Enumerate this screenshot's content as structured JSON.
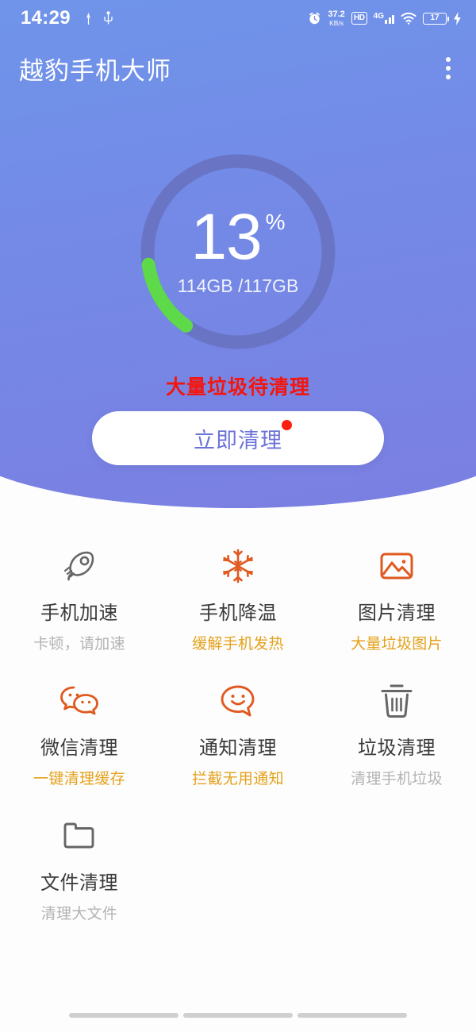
{
  "status_bar": {
    "time": "14:29",
    "net_speed_value": "37.2",
    "net_speed_unit": "KB/s",
    "hd_label": "HD",
    "network_type": "4G",
    "battery_level": "17",
    "icons": [
      "alarm-icon",
      "location-icon",
      "usb-icon",
      "hd-icon",
      "signal-icon",
      "wifi-icon",
      "battery-icon",
      "charging-bolt-icon"
    ]
  },
  "app_bar": {
    "title": "越豹手机大师",
    "menu_icon": "overflow-menu-icon"
  },
  "gauge": {
    "percent_value": "13",
    "percent_symbol": "%",
    "storage_text": "114GB /117GB",
    "used_percent": 13,
    "track_color": "#6974c4",
    "progress_color": "#5ed94a"
  },
  "warning": {
    "text": "大量垃圾待清理",
    "color": "#f3160f"
  },
  "cta": {
    "label": "立即清理",
    "badge": "notification-dot",
    "label_color": "#6b72d8"
  },
  "features": [
    {
      "icon": "rocket-icon",
      "title": "手机加速",
      "subtitle": "卡顿，请加速",
      "icon_color": "#666666",
      "subtitle_style": "gray"
    },
    {
      "icon": "snowflake-icon",
      "title": "手机降温",
      "subtitle": "缓解手机发热",
      "icon_color": "#e0591f",
      "subtitle_style": "amber"
    },
    {
      "icon": "image-icon",
      "title": "图片清理",
      "subtitle": "大量垃圾图片",
      "icon_color": "#e0591f",
      "subtitle_style": "amber"
    },
    {
      "icon": "wechat-icon",
      "title": "微信清理",
      "subtitle": "一键清理缓存",
      "icon_color": "#e0591f",
      "subtitle_style": "amber"
    },
    {
      "icon": "smiley-bubble-icon",
      "title": "通知清理",
      "subtitle": "拦截无用通知",
      "icon_color": "#e0591f",
      "subtitle_style": "amber"
    },
    {
      "icon": "trash-icon",
      "title": "垃圾清理",
      "subtitle": "清理手机垃圾",
      "icon_color": "#666666",
      "subtitle_style": "gray"
    },
    {
      "icon": "folder-icon",
      "title": "文件清理",
      "subtitle": "清理大文件",
      "icon_color": "#666666",
      "subtitle_style": "gray"
    }
  ],
  "theme": {
    "header_gradient_start": "#6f95ea",
    "header_gradient_end": "#7b7fe1"
  }
}
